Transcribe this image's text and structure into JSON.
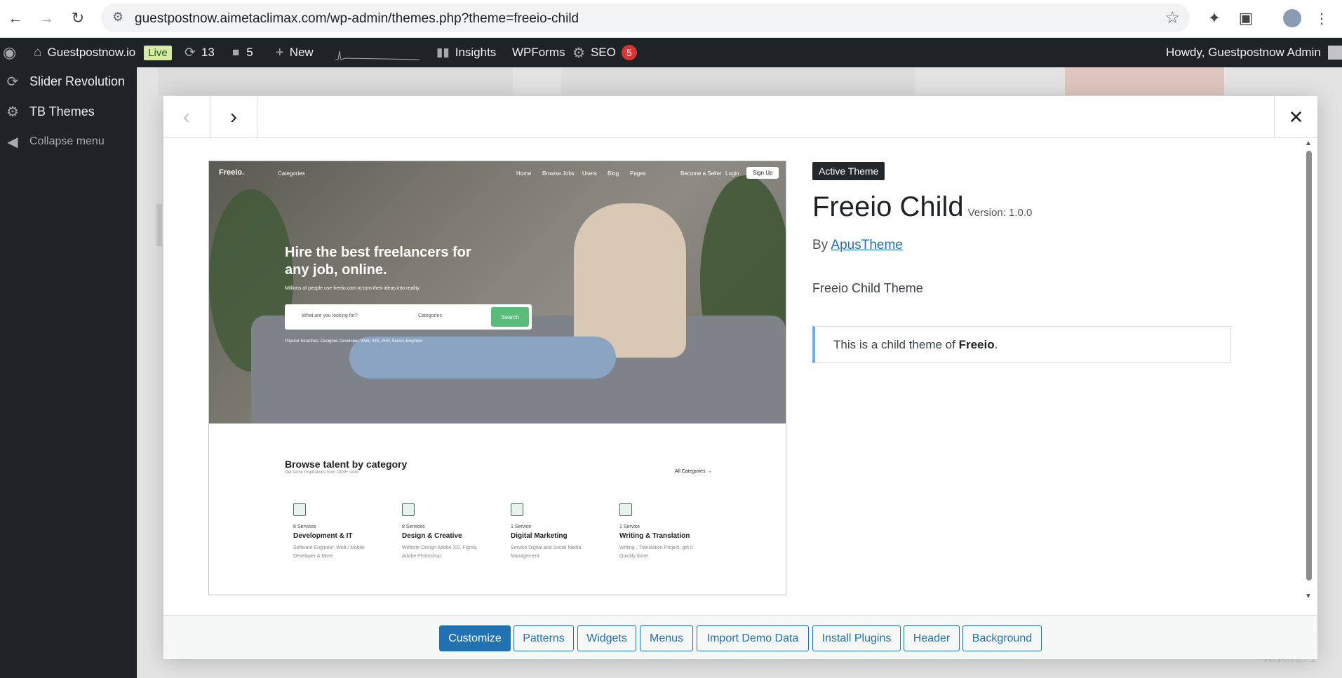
{
  "browser": {
    "url": "guestpostnow.aimetaclimax.com/wp-admin/themes.php?theme=freeio-child"
  },
  "adminbar": {
    "site_name": "Guestpostnow.io",
    "live_label": "Live",
    "updates_count": "13",
    "comments_count": "5",
    "new_label": "New",
    "insights_label": "Insights",
    "wpforms_label": "WPForms",
    "seo_label": "SEO",
    "seo_count": "5",
    "howdy": "Howdy, Guestpostnow Admin"
  },
  "sidebar": {
    "items": [
      {
        "label": "Slider Revolution",
        "icon": "refresh-icon"
      },
      {
        "label": "TB Themes",
        "icon": "gear-icon"
      },
      {
        "label": "Collapse menu",
        "icon": "collapse-icon"
      }
    ]
  },
  "theme": {
    "badge": "Active Theme",
    "name": "Freeio Child",
    "version": "Version: 1.0.0",
    "by": "By",
    "author": "ApusTheme",
    "description": "Freeio Child Theme",
    "notice_prefix": "This is a child theme of",
    "parent": "Freeio",
    "notice_suffix": "."
  },
  "screenshot": {
    "logo": "Freeio.",
    "categories_link": "Categories",
    "nav": [
      "Home",
      "Browse Jobs",
      "Users",
      "Blog",
      "Pages"
    ],
    "become_seller": "Become a Seller",
    "login": "Login",
    "signup": "Sign Up",
    "hero_title": "Hire the best freelancers for any job, online.",
    "hero_sub": "Millions of people use freeio.com to turn their ideas into reality.",
    "search_placeholder": "What are you looking for?",
    "search_category": "Categories",
    "search_button": "Search",
    "popular": "Popular Searches: Designer, Developer, Web, IOS, PHP, Senior, Engineer",
    "browse_title": "Browse talent by category",
    "browse_sub": "Get some Inspirations from 1800+ skills",
    "all_categories": "All Categories →",
    "categories": [
      {
        "count": "8 Services",
        "name": "Development & IT",
        "desc": "Software Engineer, Web / Mobile Developer & More"
      },
      {
        "count": "8 Services",
        "name": "Design & Creative",
        "desc": "Website Design Adobe XD, Figma, Adobe Photoshop"
      },
      {
        "count": "1 Service",
        "name": "Digital Marketing",
        "desc": "Service Digital and Social Media Management"
      },
      {
        "count": "1 Service",
        "name": "Writing & Translation",
        "desc": "Writing , Translation Project, get it Quickly done"
      }
    ]
  },
  "footer_buttons": [
    "Customize",
    "Patterns",
    "Widgets",
    "Menus",
    "Import Demo Data",
    "Install Plugins",
    "Header",
    "Background"
  ],
  "wp_version": "Version 6.7.2"
}
